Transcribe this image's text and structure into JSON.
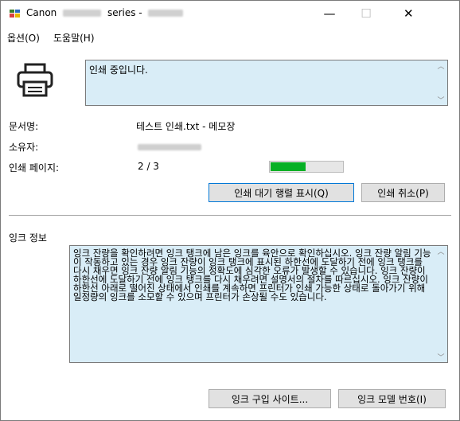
{
  "window": {
    "title_prefix": "Canon",
    "title_series": "series -",
    "minimize_glyph": "—",
    "maximize_glyph": "☐",
    "close_glyph": "✕"
  },
  "menu": {
    "options": "옵션(O)",
    "help": "도움말(H)"
  },
  "status": {
    "message": "인쇄 중입니다."
  },
  "fields": {
    "document_label": "문서명:",
    "document_value": "테스트 인쇄.txt - 메모장",
    "owner_label": "소유자:",
    "pages_label": "인쇄 페이지:",
    "pages_value": "2 / 3",
    "progress": 0.5
  },
  "buttons": {
    "show_queue": "인쇄 대기 행렬 표시(Q)",
    "cancel_print": "인쇄 취소(P)",
    "ink_site": "잉크 구입 사이트...",
    "ink_model": "잉크 모델 번호(I)"
  },
  "ink": {
    "heading": "잉크 정보",
    "message": "잉크 잔량을 확인하려면 잉크 탱크에 남은 잉크를 육안으로 확인하십시오. 잉크 잔량 알림 기능이 작동하고 있는 경우 잉크 잔량이 잉크 탱크에 표시된 하한선에 도달하기 전에 잉크 탱크를 다시 채우면 잉크 잔량 알림 기능의 정확도에 심각한 오류가 발생할 수 있습니다. 잉크 잔량이 하한선에 도달하기 전에 잉크 탱크를 다시 채우려면 설명서의 절차를 따르십시오. 잉크 잔량이 하한선 아래로 떨어진 상태에서 인쇄를 계속하면 프린터가 인쇄 가능한 상태로 돌아가기 위해 일정량의 잉크를 소모할 수 있으며 프린터가 손상될 수도 있습니다."
  },
  "icons": {
    "app": "canon-app-icon",
    "printer": "printer-icon",
    "scroll_up": "chevron-up-icon",
    "scroll_down": "chevron-down-icon"
  }
}
